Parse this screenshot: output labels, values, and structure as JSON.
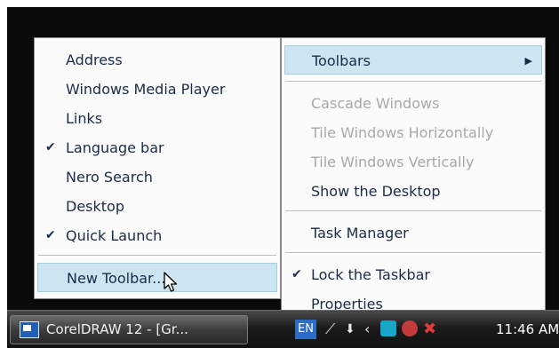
{
  "left_menu": {
    "items": [
      {
        "label": "Address",
        "checked": false
      },
      {
        "label": "Windows Media Player",
        "checked": false
      },
      {
        "label": "Links",
        "checked": false
      },
      {
        "label": "Language bar",
        "checked": true
      },
      {
        "label": "Nero Search",
        "checked": false
      },
      {
        "label": "Desktop",
        "checked": false
      },
      {
        "label": "Quick Launch",
        "checked": true
      }
    ],
    "new_toolbar": "New Toolbar..."
  },
  "right_menu": {
    "toolbars": "Toolbars",
    "cascade": "Cascade Windows",
    "tile_horizontal": "Tile Windows Horizontally",
    "tile_vertical": "Tile Windows Vertically",
    "show_desktop": "Show the Desktop",
    "task_manager": "Task Manager",
    "lock_taskbar": "Lock the Taskbar",
    "lock_taskbar_checked": true,
    "properties": "Properties"
  },
  "taskbar": {
    "task_button_label": "CorelDRAW 12 - [Gr...",
    "language": "EN",
    "clock": "11:46 AM"
  },
  "colors": {
    "menu_highlight": "#cde5f0",
    "menu_text": "#1a2b4a",
    "disabled_text": "#a8a8a8",
    "taskbar": "#1b1b1b"
  },
  "icons": {
    "check": "check-icon",
    "submenu": "submenu-arrow-icon",
    "cursor": "mouse-pointer-icon",
    "task": "coreldraw-app-icon"
  }
}
